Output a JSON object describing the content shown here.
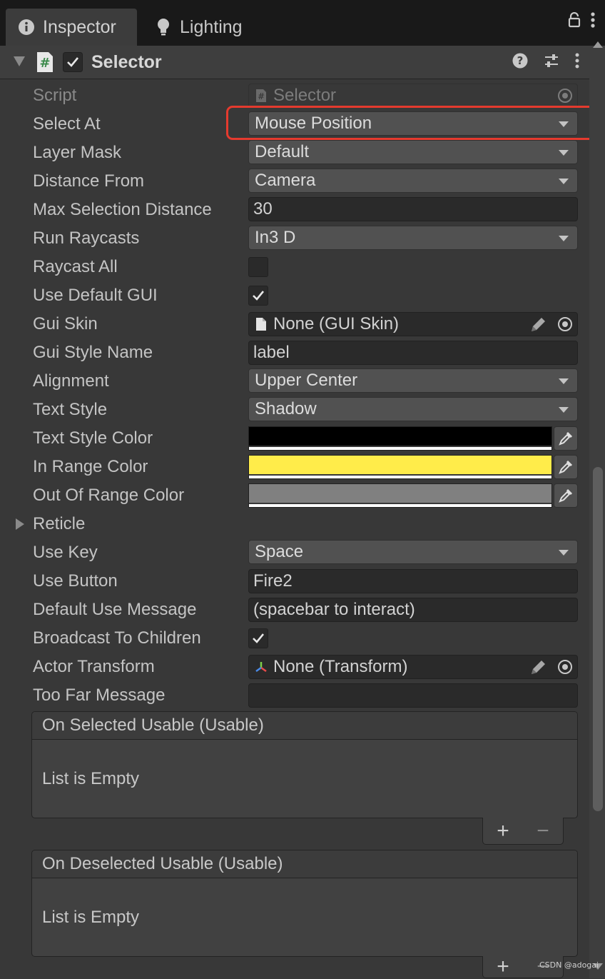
{
  "tabs": [
    {
      "label": "Inspector",
      "icon": "info-icon",
      "active": true
    },
    {
      "label": "Lighting",
      "icon": "lightbulb-icon",
      "active": false
    }
  ],
  "component": {
    "title": "Selector",
    "enabled": true,
    "icon": "script-hash-icon"
  },
  "fields": {
    "script": {
      "label": "Script",
      "value": "Selector"
    },
    "select_at": {
      "label": "Select At",
      "value": "Mouse Position"
    },
    "layer_mask": {
      "label": "Layer Mask",
      "value": "Default"
    },
    "distance_from": {
      "label": "Distance From",
      "value": "Camera"
    },
    "max_selection_distance": {
      "label": "Max Selection Distance",
      "value": "30"
    },
    "run_raycasts": {
      "label": "Run Raycasts",
      "value": "In3 D"
    },
    "raycast_all": {
      "label": "Raycast All",
      "checked": false
    },
    "use_default_gui": {
      "label": "Use Default GUI",
      "checked": true
    },
    "gui_skin": {
      "label": "Gui Skin",
      "value": "None (GUI Skin)"
    },
    "gui_style_name": {
      "label": "Gui Style Name",
      "value": "label"
    },
    "alignment": {
      "label": "Alignment",
      "value": "Upper Center"
    },
    "text_style": {
      "label": "Text Style",
      "value": "Shadow"
    },
    "text_style_color": {
      "label": "Text Style Color",
      "color": "#000000"
    },
    "in_range_color": {
      "label": "In Range Color",
      "color": "#ffec4a"
    },
    "out_of_range_color": {
      "label": "Out Of Range Color",
      "color": "#808080"
    },
    "reticle": {
      "label": "Reticle",
      "expanded": false
    },
    "use_key": {
      "label": "Use Key",
      "value": "Space"
    },
    "use_button": {
      "label": "Use Button",
      "value": "Fire2"
    },
    "default_use_message": {
      "label": "Default Use Message",
      "value": "(spacebar to interact)"
    },
    "broadcast_to_children": {
      "label": "Broadcast To Children",
      "checked": true
    },
    "actor_transform": {
      "label": "Actor Transform",
      "value": "None (Transform)"
    },
    "too_far_message": {
      "label": "Too Far Message",
      "value": ""
    }
  },
  "events": [
    {
      "title": "On Selected Usable (Usable)",
      "empty_text": "List is Empty"
    },
    {
      "title": "On Deselected Usable (Usable)",
      "empty_text": "List is Empty"
    }
  ],
  "list_buttons": {
    "add": "+",
    "remove": "−"
  },
  "watermark": "CSDN @adogai",
  "colors": {
    "highlight": "#e53a2e",
    "background": "#383838"
  }
}
